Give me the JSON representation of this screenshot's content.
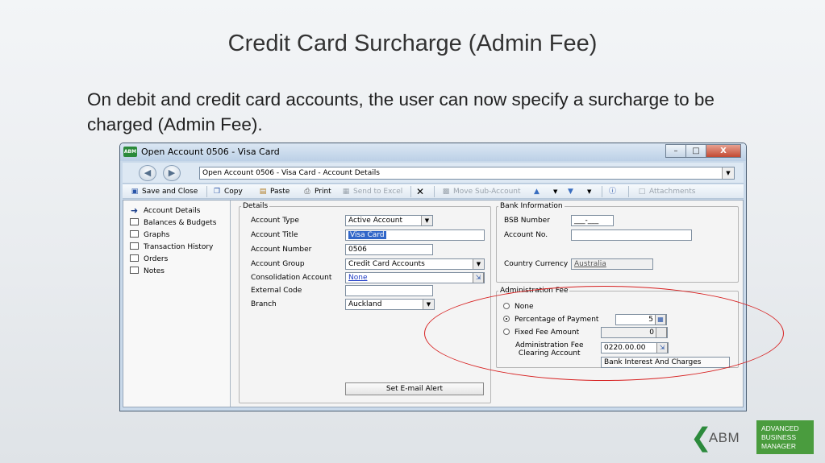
{
  "slide": {
    "title": "Credit Card Surcharge (Admin Fee)",
    "body": "On debit and credit card accounts, the user can now specify a surcharge to be charged (Admin Fee)."
  },
  "window": {
    "title": "Open Account 0506 - Visa Card",
    "app_logo": "ABM",
    "address": "Open Account 0506 - Visa Card - Account Details",
    "minimize_label": "–",
    "restore_label": "□",
    "close_label": "X"
  },
  "toolbar": {
    "save_close": "Save and Close",
    "copy": "Copy",
    "paste": "Paste",
    "print": "Print",
    "send_to_excel": "Send to Excel",
    "move_sub_account": "Move Sub-Account",
    "attachments": "Attachments"
  },
  "sidebar": {
    "items": [
      {
        "label": "Account Details",
        "icon": "arrow-right-icon"
      },
      {
        "label": "Balances & Budgets",
        "icon": "window-icon"
      },
      {
        "label": "Graphs",
        "icon": "window-icon"
      },
      {
        "label": "Transaction History",
        "icon": "window-icon"
      },
      {
        "label": "Orders",
        "icon": "window-icon"
      },
      {
        "label": "Notes",
        "icon": "window-icon"
      }
    ]
  },
  "details": {
    "legend": "Details",
    "account_type_label": "Account Type",
    "account_type_value": "Active Account",
    "account_title_label": "Account Title",
    "account_title_value": "Visa Card",
    "account_number_label": "Account Number",
    "account_number_value": "0506",
    "account_group_label": "Account Group",
    "account_group_value": "Credit Card Accounts",
    "consolidation_label": "Consolidation Account",
    "consolidation_value": "None",
    "external_code_label": "External Code",
    "external_code_value": "",
    "branch_label": "Branch",
    "branch_value": "Auckland",
    "email_alert_button": "Set E-mail Alert"
  },
  "bank": {
    "legend": "Bank Information",
    "bsb_label": "BSB Number",
    "bsb_value": "___-___",
    "account_no_label": "Account No.",
    "account_no_value": "",
    "currency_label": "Country Currency",
    "currency_value": "Australia"
  },
  "admin_fee": {
    "legend": "Administration Fee",
    "option_none": "None",
    "option_percentage": "Percentage of Payment",
    "percentage_value": "5",
    "option_fixed": "Fixed Fee Amount",
    "fixed_value": "0",
    "clearing_label_line1": "Administration Fee",
    "clearing_label_line2": "Clearing Account",
    "clearing_value": "0220.00.00",
    "clearing_description": "Bank Interest And Charges",
    "selected": "percentage"
  },
  "brand": {
    "mark": "ABM",
    "line1": "ADVANCED",
    "line2": "BUSINESS",
    "line3": "MANAGER",
    "accent": "#4a9c3e",
    "highlight": "#d72020"
  }
}
